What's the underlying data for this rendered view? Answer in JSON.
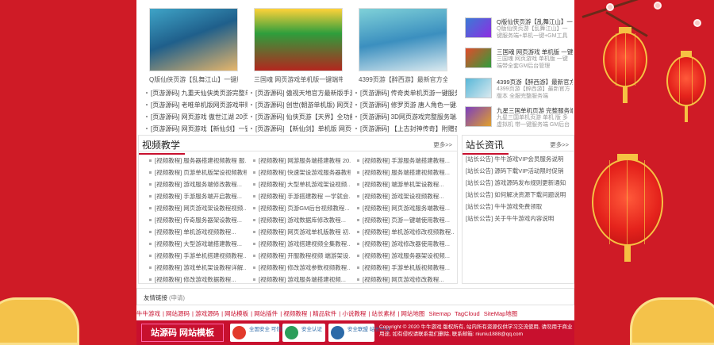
{
  "games": [
    {
      "caption": "Q版仙侠页游【乱舞江山】一键服务端+..."
    },
    {
      "caption": "三国魂 网页游戏单机版一键端带全套主线..."
    },
    {
      "caption": "4399页游【醉西游】最新官方全一键..."
    }
  ],
  "game_links": [
    [
      "[页游源码] 九重天仙侠类页游完整单机...",
      "[页游源码] 老唯单机版网页游戏带赠送...",
      "[页游源码] 网页游戏 傲世江湖 20页游...",
      "[页游源码] 网页游戏【新仙剑】一键即..."
    ],
    [
      "[页游源码] 傲视天地官方最新版手游...",
      "[页游源码] 创世(朝游单机版) 网页游戏...",
      "[页游源码] 仙侠页游【天界】全功能完...",
      "[页游源码] 【新仙剑】单机版 网页一键..."
    ],
    [
      "[页游源码] 传奇类单机页游一键服务...",
      "[页游源码] 修罗页游 唐人角色一键单...",
      "[页游源码] 3D网页游戏完整服务端...",
      "[页游源码] 【上古封神传奇】附赠查..."
    ]
  ],
  "side_items": [
    {
      "title": "Q版仙侠页游【乱舞江山】一键服务...",
      "desc": "Q版仙侠页游【乱舞江山】一键服务端+单机一键+GM工具"
    },
    {
      "title": "三国魂 网页游戏 单机版 一键服务端...",
      "desc": "三国魂 网页游戏 单机版 一键端带全套GM后台管理"
    },
    {
      "title": "4399页游【醉西游】最新官方版...",
      "desc": "4399页游【醉西游】最新官方版本 全服完整服务端"
    },
    {
      "title": "九星三国单机页游 完整服务端...",
      "desc": "九星三国单机页游 单机 版 多 虚拟机 带一键服务端 GM后台"
    }
  ],
  "video": {
    "title": "视频教学",
    "more": "更多>>",
    "cols": [
      [
        "[视频教程] 服务器搭建视频教程 服...",
        "[视频教程] 页游单机版架设视频教程...",
        "[视频教程] 游戏服务端修改教程...",
        "[视频教程] 手游服务端开启教程...",
        "[视频教程] 网页游戏架设教程视频...",
        "[视频教程] 传奇服务器架设教程...",
        "[视频教程] 单机游戏视频教程...",
        "[视频教程] 大型游戏端搭建教程...",
        "[视频教程] 手游单机搭建视频教程...",
        "[视频教程] 游戏单机架设教程详解...",
        "[视频教程] 修改游戏数据教程...",
        "[视频教程] 手游一键端使用视频教程..."
      ],
      [
        "[视频教程] 网游服务端搭建教程 20...",
        "[视频教程] 快速架设游戏服务器教程...",
        "[视频教程] 大型单机游戏架设视频...",
        "[视频教程] 手游搭建教程 一学就会...",
        "[视频教程] 页游GM后台视频教程...",
        "[视频教程] 游戏数据库修改教程...",
        "[视频教程] 网页游戏单机版教程 初...",
        "[视频教程] 游戏搭建视频全集教程...",
        "[视频教程] 开服教程视频 端游架设...",
        "[视频教程] 修改游戏参数视频教程...",
        "[视频教程] 游戏服务端搭建视频...",
        "[视频教程] 手游开服GM工具教程..."
      ],
      [
        "[视频教程] 手游服务端搭建教程...",
        "[视频教程] 服务端搭建视频教程...",
        "[视频教程] 端游单机架设教程...",
        "[视频教程] 游戏架设视频教程...",
        "[视频教程] 网页游戏服务端教程...",
        "[视频教程] 页游一键端使用教程...",
        "[视频教程] 单机游戏修改视频教程...",
        "[视频教程] 游戏修改器使用教程...",
        "[视频教程] 游戏服务器架设视频...",
        "[视频教程] 手游单机版视频教程...",
        "[视频教程] 网页游戏修改教程...",
        "[视频教程] 2018游戏架设视频教程..."
      ]
    ]
  },
  "news": {
    "title": "站长资讯",
    "more": "更多>>",
    "items": [
      "[站长公告] 牛牛游戏VIP会员服务说明",
      "[站长公告] 源码下载VIP活动限时促销",
      "[站长公告] 游戏源码发布规则更新通知",
      "[站长公告] 如何解决资源下载问题说明",
      "[站长公告] 牛牛游戏免费领取",
      "[站长公告] 关于牛牛游戏内容说明"
    ]
  },
  "friend": {
    "label": "友情链接",
    "value": "(申请)"
  },
  "footer_links": [
    "牛牛游戏",
    "网站源码",
    "游戏源码",
    "网站模板",
    "网站插件",
    "视频教程",
    "精品软件",
    "小说教程",
    "站长素材",
    "网站地图",
    "Sitemap",
    "TagCloud",
    "SiteMap地图"
  ],
  "footer": {
    "logo": "站源码 网站模板",
    "badge1": "全国安全 可信网站",
    "badge2": "安全认证",
    "badge3": "安全联盟 站长平台",
    "copyright": "Copyright © 2020 牛牛游戏 版权所有, 站内所有资源仅供学习交流使用, 请勿用于商业用途, 如有侵权请联系我们删除, 联系邮箱: niuniu1888@qq.com"
  },
  "colors": {
    "accent": "#c8102e",
    "lantern": "#e5231c",
    "gold": "#f6c143"
  }
}
